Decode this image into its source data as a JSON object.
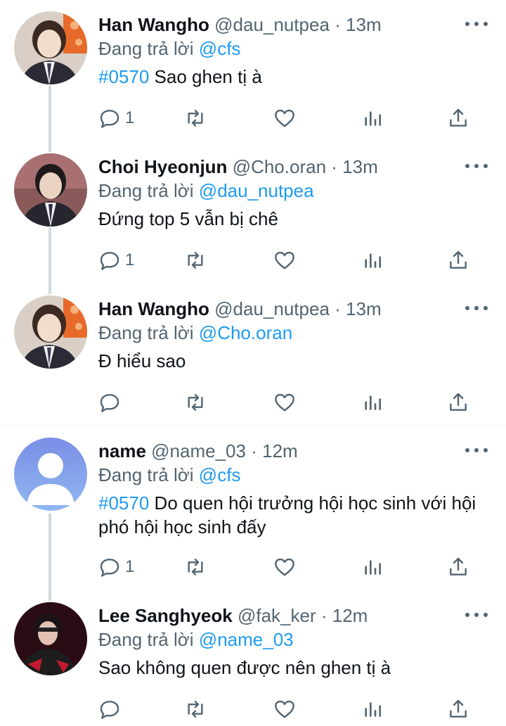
{
  "reply_prefix": "Đang trả lời",
  "colors": {
    "link": "#1d9bf0",
    "muted": "#536471",
    "thread_line": "#cfd9de"
  },
  "icons": {
    "reply": "reply-icon",
    "retweet": "retweet-icon",
    "like": "heart-icon",
    "views": "analytics-icon",
    "share": "share-icon",
    "more": "more-icon"
  },
  "tweets": [
    {
      "name": "Han Wangho",
      "handle": "@dau_nutpea",
      "dot": "·",
      "time": "13m",
      "reply_to": "@cfs",
      "hashtag": "#0570",
      "text": "Sao ghen tị à",
      "reply_count": "1",
      "avatar": "photo-avatar"
    },
    {
      "name": "Choi Hyeonjun",
      "handle": "@Cho.oran",
      "dot": "·",
      "time": "13m",
      "reply_to": "@dau_nutpea",
      "hashtag": "",
      "text": "Đứng top 5 vẫn bị chê",
      "reply_count": "1",
      "avatar": "photo-avatar"
    },
    {
      "name": "Han Wangho",
      "handle": "@dau_nutpea",
      "dot": "·",
      "time": "13m",
      "reply_to": "@Cho.oran",
      "hashtag": "",
      "text": "Đ hiểu sao",
      "reply_count": "",
      "avatar": "photo-avatar"
    },
    {
      "name": "name",
      "handle": "@name_03",
      "dot": "·",
      "time": "12m",
      "reply_to": "@cfs",
      "hashtag": "#0570",
      "text": "Do quen hội trưởng hội học sinh với hội phó hội học sinh đấy",
      "reply_count": "1",
      "avatar": "default-avatar"
    },
    {
      "name": "Lee Sanghyeok",
      "handle": "@fak_ker",
      "dot": "·",
      "time": "12m",
      "reply_to": "@name_03",
      "hashtag": "",
      "text": "Sao không quen được nên ghen tị à",
      "reply_count": "",
      "avatar": "photo-avatar"
    }
  ]
}
